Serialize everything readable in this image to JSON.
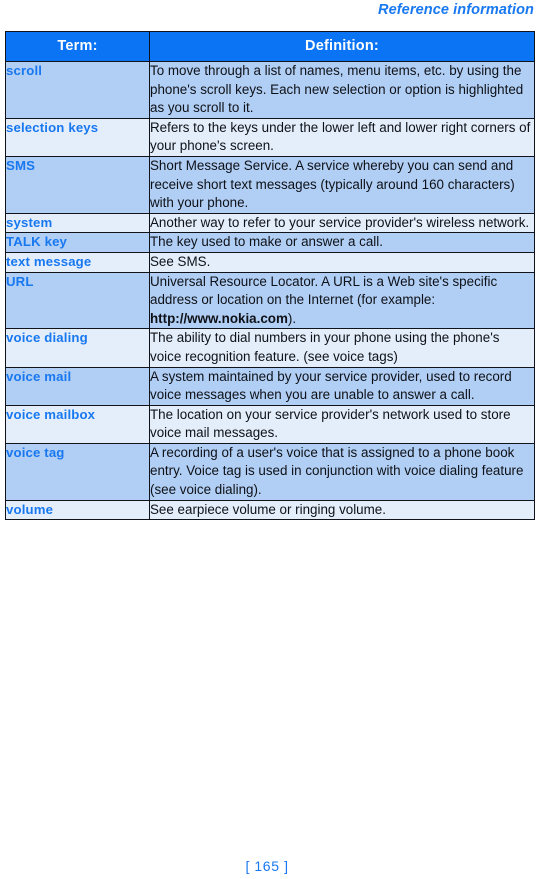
{
  "header": {
    "running_title": "Reference information"
  },
  "table": {
    "columns": [
      "Term:",
      "Definition:"
    ],
    "rows": [
      {
        "term": "scroll",
        "definition": "To move through a list of names, menu items, etc. by using the phone's scroll keys. Each new selection or option is highlighted as you scroll to it.",
        "tint": "dark"
      },
      {
        "term": "selection keys",
        "definition": "Refers to the keys under the lower left and lower right corners of your phone's screen.",
        "tint": "light"
      },
      {
        "term": "SMS",
        "definition": "Short Message Service. A service whereby you can send and receive short text messages (typically around 160 characters) with your phone.",
        "tint": "dark"
      },
      {
        "term": "system",
        "definition": "Another way to refer to your service provider's wireless network.",
        "tint": "light"
      },
      {
        "term": "TALK key",
        "definition": "The key used to make or answer a call.",
        "tint": "dark"
      },
      {
        "term": "text message",
        "definition": "See SMS.",
        "tint": "light"
      },
      {
        "term": "URL",
        "definition_prefix": "Universal Resource Locator. A URL is a Web site's specific address or location on the Internet (for example:",
        "definition_link": "http://www.nokia.com",
        "definition_suffix": ").",
        "tint": "dark"
      },
      {
        "term": "voice dialing",
        "definition": "The ability to dial numbers in your phone using the phone's voice recognition feature.  (see voice tags)",
        "tint": "light"
      },
      {
        "term": "voice mail",
        "definition": "A system maintained by your service provider, used to record voice messages when you are unable to answer a call.",
        "tint": "dark"
      },
      {
        "term": "voice mailbox",
        "definition": "The location on your service provider's network used to store voice mail messages.",
        "tint": "light"
      },
      {
        "term": "voice tag",
        "definition": "A recording of a user's voice that is assigned to a phone book entry. Voice tag is used in conjunction with voice dialing feature (see voice dialing).",
        "tint": "dark"
      },
      {
        "term": "volume",
        "definition": "See earpiece volume or ringing volume.",
        "tint": "light"
      }
    ]
  },
  "footer": {
    "page_number": "[ 165 ]"
  },
  "colors": {
    "accent_blue": "#1878f0",
    "header_blue": "#0b74f5",
    "row_tint_dark": "#b1cef4",
    "row_tint_light": "#e4eefb",
    "border": "#11131a",
    "body_text": "#0e1117"
  }
}
